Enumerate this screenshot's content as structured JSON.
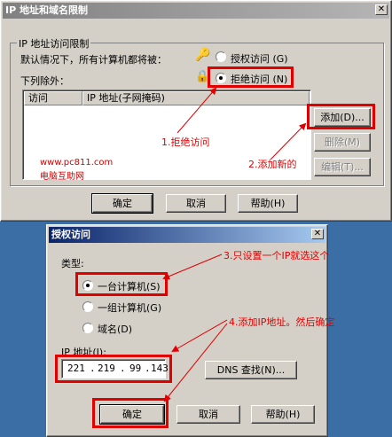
{
  "window1": {
    "title": "IP 地址和域名限制",
    "group_label": "IP 地址访问限制",
    "default_text": "默认情况下，所有计算机都将被：",
    "grant_label": "授权访问 (G)",
    "deny_label": "拒绝访问 (N)",
    "except_text": "下列除外：",
    "columns": [
      "访问",
      "IP 地址(子网掩码)"
    ],
    "add_button": "添加(D)...",
    "remove_button": "删除(M)",
    "edit_button": "编辑(T)...",
    "ok_button": "确定",
    "cancel_button": "取消",
    "help_button": "帮助(H)",
    "watermark_url": "www.pc811.com",
    "watermark_name": "电脑互助网"
  },
  "window2": {
    "title": "授权访问",
    "type_label": "类型:",
    "single_label": "一台计算机(S)",
    "group_label": "一组计算机(G)",
    "domain_label": "域名(D)",
    "ip_label": "IP 地址(I):",
    "ip_octets": [
      "221",
      "219",
      "99",
      "143"
    ],
    "dns_button": "DNS 查找(N)...",
    "ok_button": "确定",
    "cancel_button": "取消",
    "help_button": "帮助(H)"
  },
  "annotations": {
    "a1": "1.拒绝访问",
    "a2": "2.添加新的",
    "a3": "3.只设置一个IP就选这个",
    "a4": "4.添加IP地址。然后确定"
  },
  "colors": {
    "annotation": "#e00000",
    "desktop": "#3a6ea5",
    "dialog": "#d4d0c8"
  }
}
